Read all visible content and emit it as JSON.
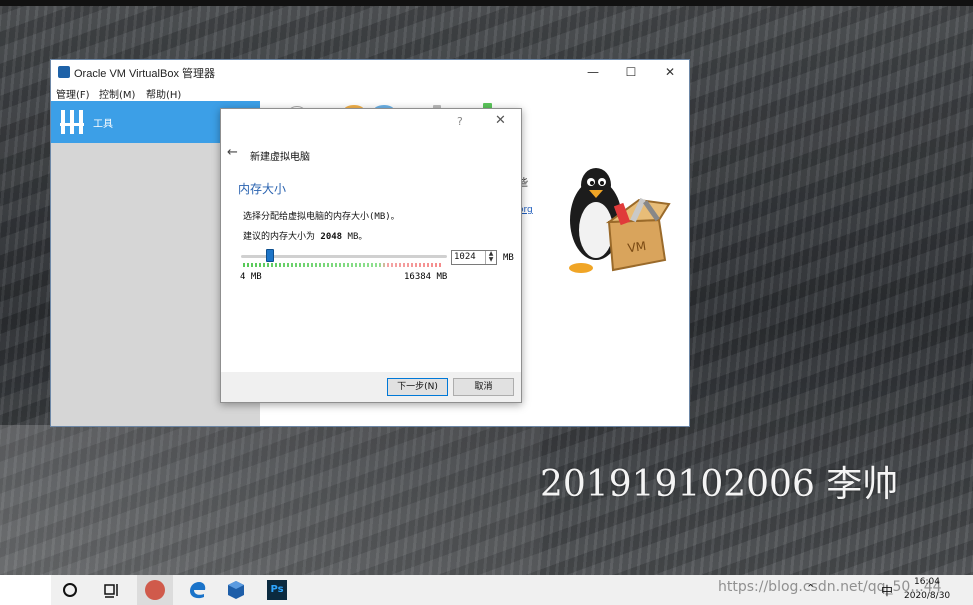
{
  "desktop": {
    "watermark_name": "201919102006 李帅"
  },
  "main_window": {
    "title": "Oracle VM VirtualBox 管理器",
    "window_controls": {
      "minimize": "—",
      "maximize": "☐",
      "close": "✕"
    },
    "menu": [
      "管理(F)",
      "控制(M)",
      "帮助(H)"
    ],
    "sidebar": {
      "tools_label": "工具"
    },
    "welcome_partial_text": "些",
    "welcome_partial_link": "org"
  },
  "dialog": {
    "help": "?",
    "close": "✕",
    "back_icon": "←",
    "caption": "新建虚拟电脑",
    "heading": "内存大小",
    "description_line1": "选择分配给虚拟电脑的内存大小(MB)。",
    "description_line2_prefix": "建议的内存大小为 ",
    "description_line2_value": "2048",
    "description_line2_suffix": " MB。",
    "memory": {
      "value": "1024",
      "unit": "MB",
      "min_label": "4 MB",
      "max_label": "16384 MB",
      "min": 4,
      "max": 16384,
      "current": 1024
    },
    "next_button": "下一步(N)",
    "cancel_button": "取消"
  },
  "taskbar": {
    "ps_label": "Ps",
    "tray_overlay_text": "https://blog.csdn.net/qq_50...44",
    "ime": "中",
    "time": "16:04",
    "date": "2020/8/30"
  }
}
